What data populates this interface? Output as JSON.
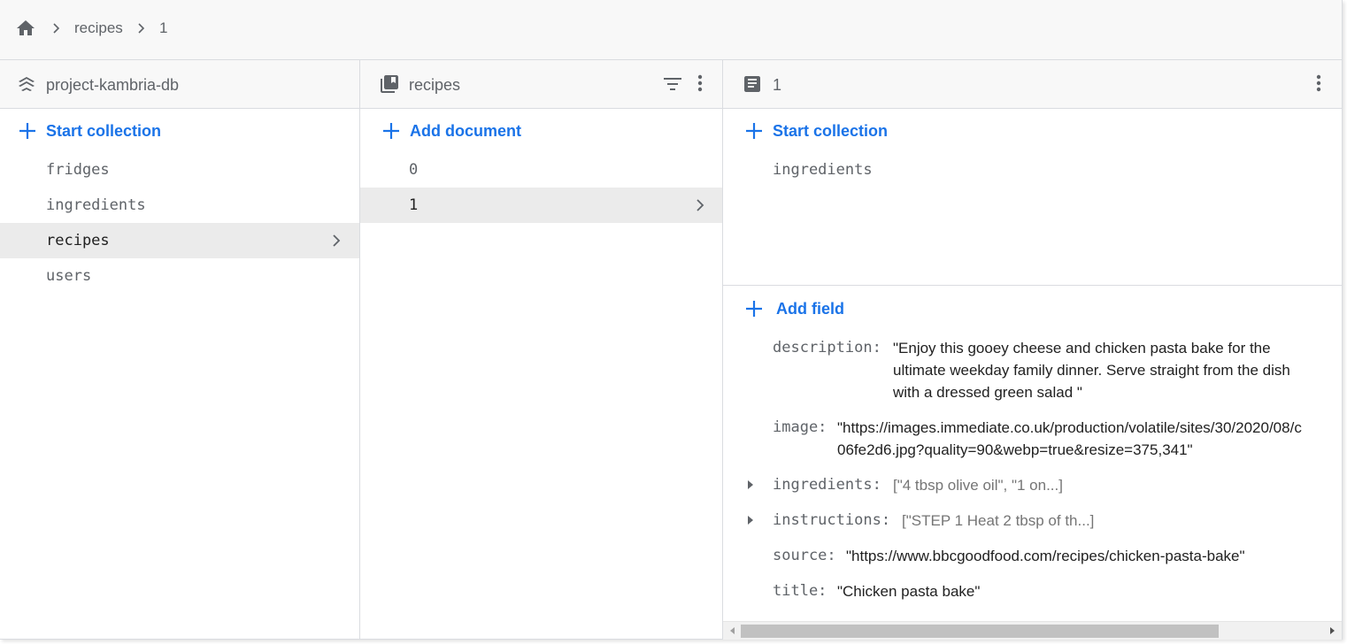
{
  "breadcrumb": {
    "home_icon": "home-icon",
    "items": [
      "recipes",
      "1"
    ]
  },
  "colors": {
    "accent": "#1a73e8",
    "header_bg": "#f8f8f8",
    "selected_bg": "#ebebeb",
    "muted_text": "#5f6368"
  },
  "root_panel": {
    "icon": "firestore-db-icon",
    "title": "project-kambria-db",
    "start_collection_label": "Start collection",
    "collections": [
      {
        "name": "fridges",
        "selected": false
      },
      {
        "name": "ingredients",
        "selected": false
      },
      {
        "name": "recipes",
        "selected": true
      },
      {
        "name": "users",
        "selected": false
      }
    ]
  },
  "collection_panel": {
    "icon": "collection-icon",
    "title": "recipes",
    "filter_icon": "filter-icon",
    "more_icon": "more-vert-icon",
    "add_document_label": "Add document",
    "documents": [
      {
        "id": "0",
        "selected": false
      },
      {
        "id": "1",
        "selected": true
      }
    ]
  },
  "document_panel": {
    "icon": "document-icon",
    "title": "1",
    "more_icon": "more-vert-icon",
    "start_collection_label": "Start collection",
    "subcollections": [
      "ingredients"
    ],
    "add_field_label": "Add field",
    "fields": {
      "description": {
        "key": "description:",
        "line1": "\"Enjoy this gooey cheese and chicken pasta bake for the",
        "line2": "ultimate weekday family dinner. Serve straight from the dish",
        "line3": "with a dressed green salad \""
      },
      "image": {
        "key": "image:",
        "line1": "\"https://images.immediate.co.uk/production/volatile/sites/30/2020/08/c",
        "line2": "06fe2d6.jpg?quality=90&webp=true&resize=375,341\""
      },
      "ingredients": {
        "key": "ingredients:",
        "value": "[\"4 tbsp olive oil\", \"1 on...]"
      },
      "instructions": {
        "key": "instructions:",
        "value": "[\"STEP 1 Heat 2 tbsp of th...]"
      },
      "source": {
        "key": "source:",
        "value": "\"https://www.bbcgoodfood.com/recipes/chicken-pasta-bake\""
      },
      "title": {
        "key": "title:",
        "value": "\"Chicken pasta bake\""
      }
    }
  }
}
